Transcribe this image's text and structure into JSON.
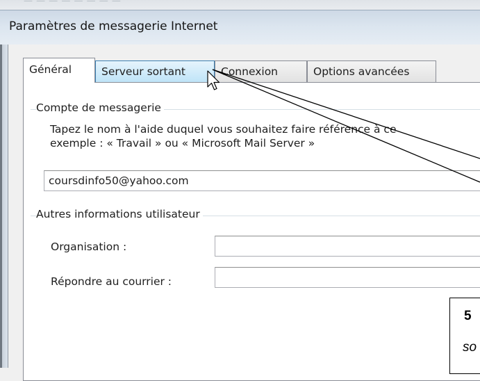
{
  "window": {
    "title": "Paramètres de messagerie Internet"
  },
  "tabs": [
    {
      "label": "Général",
      "state": "active"
    },
    {
      "label": "Serveur sortant",
      "state": "hover"
    },
    {
      "label": "Connexion",
      "state": "normal"
    },
    {
      "label": "Options avancées",
      "state": "normal"
    }
  ],
  "account_group": {
    "label": "Compte de messagerie",
    "description_line1": "Tapez le nom à l'aide duquel vous souhaitez faire référence à ce",
    "description_line2": "exemple : « Travail » ou « Microsoft Mail Server »",
    "account_name_value": "coursdinfo50@yahoo.com"
  },
  "user_info_group": {
    "label": "Autres informations utilisateur",
    "organisation_label": "Organisation :",
    "organisation_value": "",
    "reply_label": "Répondre au courrier :",
    "reply_value": ""
  },
  "callout": {
    "number": "5",
    "text": "so"
  },
  "icons": {
    "pointer": "mouse-pointer-icon"
  }
}
